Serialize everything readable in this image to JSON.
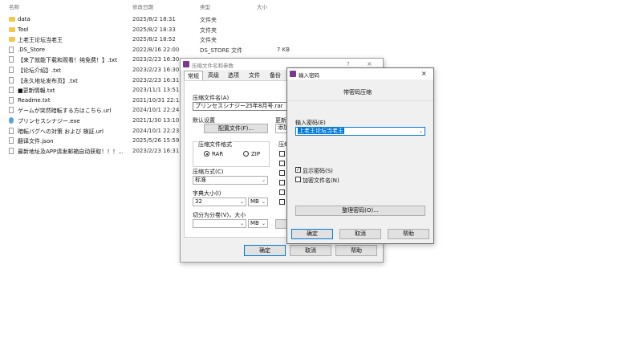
{
  "explorer": {
    "headers": {
      "name": "名称",
      "date": "修改日期",
      "type": "类型",
      "size": "大小"
    },
    "rows": [
      {
        "name": "data",
        "date": "2025/8/2 18:31",
        "type": "文件夹",
        "size": "",
        "icon": "folder-icon"
      },
      {
        "name": "Tool",
        "date": "2025/8/2 18:33",
        "type": "文件夹",
        "size": "",
        "icon": "folder-icon"
      },
      {
        "name": "上老王论坛当老王",
        "date": "2025/8/2 18:52",
        "type": "文件夹",
        "size": "",
        "icon": "folder-icon"
      },
      {
        "name": ".DS_Store",
        "date": "2022/8/16 22:00",
        "type": "DS_STORE 文件",
        "size": "7 KB",
        "icon": "file-icon"
      },
      {
        "name": "【来了就能下载和观看！纯免费！】.txt",
        "date": "2023/2/23 16:30",
        "type": "",
        "size": "",
        "icon": "text-file-icon"
      },
      {
        "name": "【论坛介绍】.txt",
        "date": "2023/2/23 16:30",
        "type": "",
        "size": "",
        "icon": "text-file-icon"
      },
      {
        "name": "【永久地址发布页】.txt",
        "date": "2023/2/23 16:31",
        "type": "",
        "size": "",
        "icon": "text-file-icon"
      },
      {
        "name": "■更新情報.txt",
        "date": "2023/11/1 13:51",
        "type": "",
        "size": "",
        "icon": "text-file-icon"
      },
      {
        "name": "Readme.txt",
        "date": "2021/10/31 22:13",
        "type": "",
        "size": "",
        "icon": "text-file-icon"
      },
      {
        "name": "ゲームが突然暗転する方はこちら.url",
        "date": "2024/10/1 22:24",
        "type": "",
        "size": "",
        "icon": "url-file-icon"
      },
      {
        "name": "プリンセスシナジー.exe",
        "date": "2021/1/30 13:10",
        "type": "",
        "size": "",
        "icon": "app-icon"
      },
      {
        "name": "暗転バグへの対策 および 検証.url",
        "date": "2024/10/1 22:23",
        "type": "",
        "size": "",
        "icon": "url-file-icon"
      },
      {
        "name": "翻译文件.json",
        "date": "2025/5/26 15:59",
        "type": "",
        "size": "",
        "icon": "json-file-icon"
      },
      {
        "name": "最新地址及APP请发邮箱自动获取！！！...",
        "date": "2023/2/23 16:31",
        "type": "",
        "size": "",
        "icon": "text-file-icon"
      }
    ]
  },
  "archive_dialog": {
    "title": "压缩文件名和参数",
    "title_buttons": [
      "?",
      "×"
    ],
    "tabs": [
      "常规",
      "高级",
      "选项",
      "文件",
      "备份"
    ],
    "archive_name_label": "压缩文件名(A)",
    "archive_name_value": "プリンセスシナジー25年8月号.rar",
    "default_config_label": "默认设置",
    "config_button": "配置文件(F)...",
    "update_label": "更新",
    "add_button": "添加",
    "format_group": "压缩文件格式",
    "format_options": [
      "RAR",
      "ZIP"
    ],
    "selected_format": "RAR",
    "options_group_label": "压缩",
    "method_label": "压缩方式(C)",
    "method_value": "标准",
    "dict_label": "字典大小(I)",
    "dict_value": "32",
    "dict_unit": "MB",
    "split_label": "切分为分卷(V)，大小",
    "split_value": "",
    "split_unit": "MB",
    "ok": "确定",
    "cancel": "取消",
    "help": "帮助"
  },
  "password_dialog": {
    "title": "输入密码",
    "close": "×",
    "heading": "带密码压缩",
    "password_label": "输入密码(E)",
    "password_value": "上老王论坛当老王",
    "show_password": "显示密码(S)",
    "show_password_checked": true,
    "encrypt_names": "加密文件名(N)",
    "encrypt_names_checked": false,
    "organize_button": "整理密码(O)...",
    "ok": "确定",
    "cancel": "取消",
    "help": "帮助"
  },
  "colors": {
    "folder": "#f2c94c",
    "selection": "#0078d7",
    "accent": "#7a3b8f"
  }
}
